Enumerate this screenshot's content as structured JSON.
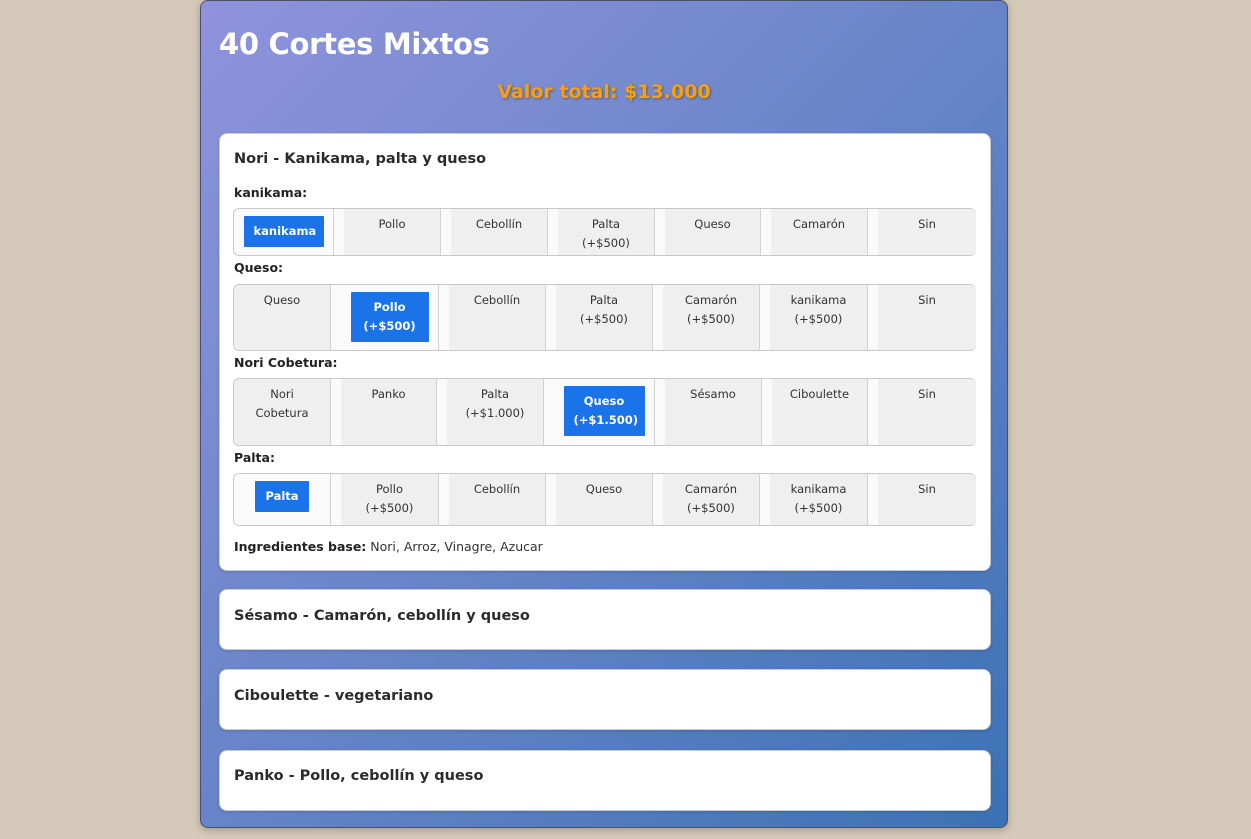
{
  "page": {
    "title": "40 Cortes Mixtos",
    "total": "Valor total: $13.000"
  },
  "cards": [
    {
      "title": "Nori - Kanikama, palta y queso",
      "groups": [
        {
          "label": "kanikama:",
          "options": [
            "kanikama",
            "Pollo",
            "Cebollín",
            "Palta (+$500)",
            "Queso",
            "Camarón",
            "Sin"
          ],
          "selected": "kanikama"
        },
        {
          "label": "Queso:",
          "options": [
            "Queso",
            "Pollo (+$500)",
            "Cebollín",
            "Palta (+$500)",
            "Camarón (+$500)",
            "kanikama (+$500)",
            "Sin"
          ],
          "selected": "Pollo (+$500)"
        },
        {
          "label": "Nori Cobetura:",
          "options": [
            "Nori Cobetura",
            "Panko",
            "Palta (+$1.000)",
            "Queso (+$1.500)",
            "Sésamo",
            "Ciboulette",
            "Sin"
          ],
          "selected": "Queso (+$1.500)"
        },
        {
          "label": "Palta:",
          "options": [
            "Palta",
            "Pollo (+$500)",
            "Cebollín",
            "Queso",
            "Camarón (+$500)",
            "kanikama (+$500)",
            "Sin"
          ],
          "selected": "Palta"
        }
      ],
      "base_label": "Ingredientes base:",
      "base_value": "Nori, Arroz, Vinagre, Azucar"
    },
    {
      "title": "Sésamo - Camarón, cebollín y queso"
    },
    {
      "title": "Ciboulette - vegetariano"
    },
    {
      "title": "Panko - Pollo, cebollín y queso"
    }
  ],
  "colors": {
    "accent": "#1a73e8",
    "total": "#f2a01b",
    "page_bg": "#d5c9b9"
  }
}
